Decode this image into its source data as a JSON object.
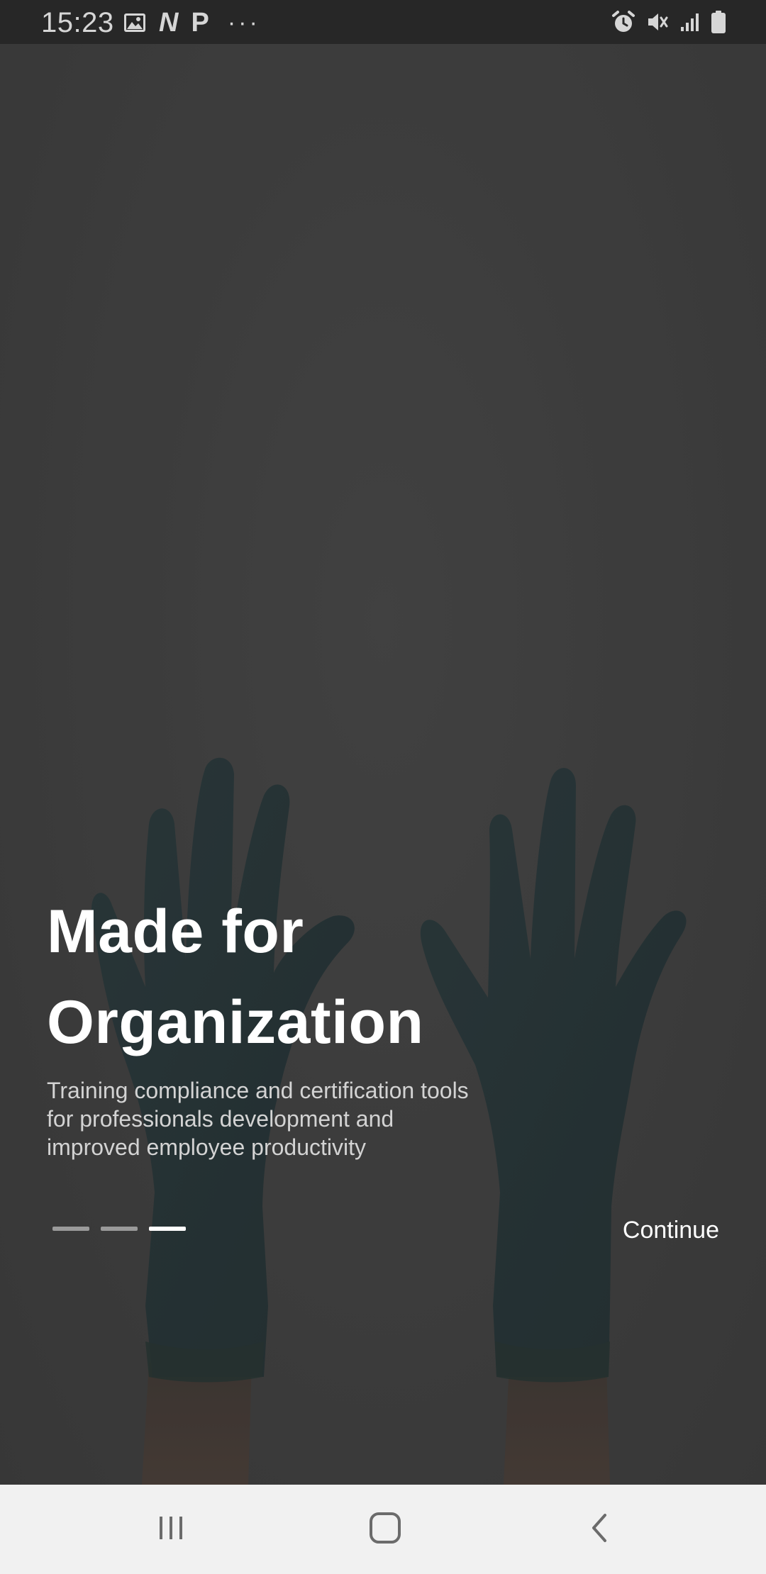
{
  "status_bar": {
    "time": "15:23",
    "left_icons": [
      "image-icon",
      "n-app-icon",
      "p-app-icon",
      "more-notifications-icon"
    ],
    "right_icons": [
      "alarm-icon",
      "mute-icon",
      "signal-icon",
      "battery-icon"
    ],
    "n_glyph": "N",
    "p_glyph": "P",
    "dots": "···"
  },
  "onboarding": {
    "title_line1": "Made for",
    "title_line2": "Organization",
    "subtitle_line1": "Training compliance and certification tools",
    "subtitle_line2": "for professionals development and",
    "subtitle_line3": "improved employee productivity",
    "pages_total": 3,
    "current_page": 3,
    "continue_label": "Continue",
    "background_image": "hands-in-blue-gloves",
    "colors": {
      "overlay": "#3b3b3b",
      "glove": "#223336",
      "text": "#ffffff",
      "subtext": "#d3d3d3",
      "dot_inactive": "#9a9a9a",
      "dot_active": "#ffffff"
    }
  },
  "nav_bar": {
    "recents": "recents-icon",
    "home": "home-icon",
    "back": "back-icon"
  }
}
